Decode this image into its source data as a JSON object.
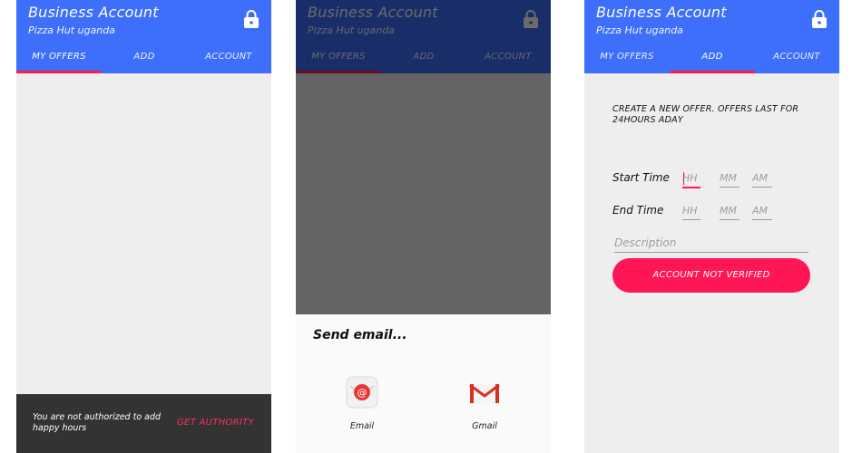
{
  "app": {
    "title": "Business Account",
    "subtitle": "Pizza Hut uganda",
    "tabs": [
      "MY OFFERS",
      "ADD",
      "ACCOUNT"
    ]
  },
  "screen1": {
    "active_tab": "MY OFFERS",
    "snackbar": {
      "message": "You are not authorized to add happy hours",
      "action": "GET AUTHORITY"
    }
  },
  "screen2": {
    "active_tab": "MY OFFERS",
    "share_sheet": {
      "title": "Send email...",
      "options": [
        {
          "label": "Email",
          "icon": "email-app-icon"
        },
        {
          "label": "Gmail",
          "icon": "gmail-icon"
        }
      ]
    }
  },
  "screen3": {
    "active_tab": "ADD",
    "heading": "CREATE A NEW OFFER. OFFERS LAST FOR 24HOURS ADAY",
    "start_time": {
      "label": "Start Time",
      "hour_placeholder": "HH",
      "minute_placeholder": "MM",
      "ampm_placeholder": "AM"
    },
    "end_time": {
      "label": "End Time",
      "hour_placeholder": "HH",
      "minute_placeholder": "MM",
      "ampm_placeholder": "AM"
    },
    "description_placeholder": "Description",
    "button_label": "ACCOUNT NOT VERIFIED"
  },
  "colors": {
    "app_bar": "#3d6ffb",
    "accent": "#ff1654",
    "snackbar": "#333333",
    "background": "#eeeeee"
  }
}
